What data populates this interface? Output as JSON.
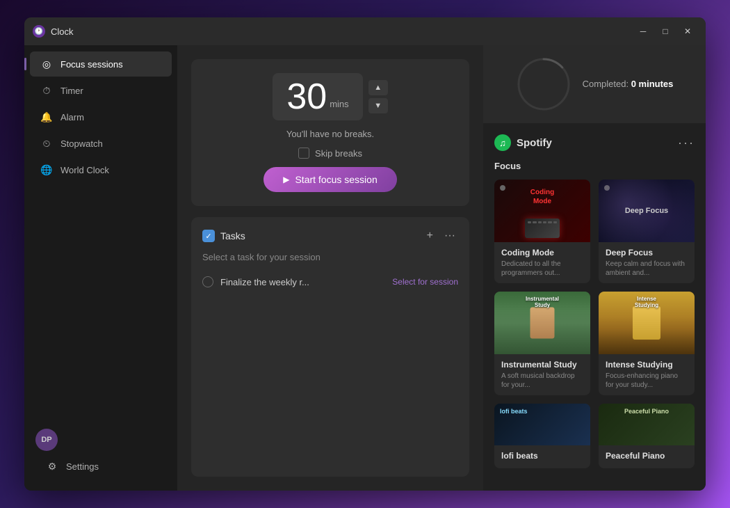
{
  "window": {
    "title": "Clock",
    "app_icon": "🕐"
  },
  "titlebar": {
    "minimize_label": "─",
    "maximize_label": "□",
    "close_label": "✕"
  },
  "sidebar": {
    "items": [
      {
        "id": "focus-sessions",
        "label": "Focus sessions",
        "icon": "◎",
        "active": true
      },
      {
        "id": "timer",
        "label": "Timer",
        "icon": "⏱"
      },
      {
        "id": "alarm",
        "label": "Alarm",
        "icon": "🔔"
      },
      {
        "id": "stopwatch",
        "label": "Stopwatch",
        "icon": "⏲"
      },
      {
        "id": "world-clock",
        "label": "World Clock",
        "icon": "🌐"
      }
    ],
    "avatar_initials": "DP",
    "settings_label": "Settings",
    "settings_icon": "⚙"
  },
  "focus_panel": {
    "time_value": "30",
    "time_unit": "mins",
    "no_breaks_text": "You'll have no breaks.",
    "skip_breaks_label": "Skip breaks",
    "start_button_label": "Start focus session"
  },
  "tasks_panel": {
    "title": "Tasks",
    "select_prompt": "Select a task for your session",
    "add_icon": "+",
    "more_icon": "···",
    "tasks": [
      {
        "name": "Finalize the weekly r...",
        "action_label": "Select for session"
      }
    ]
  },
  "completed_panel": {
    "label": "Completed:",
    "value": "0 minutes"
  },
  "spotify": {
    "name": "Spotify",
    "section_label": "Focus",
    "more_icon": "···",
    "playlists": [
      {
        "id": "coding-mode",
        "name": "Coding Mode",
        "description": "Dedicated to all the programmers out...",
        "dot_color": "gray",
        "thumb_type": "coding"
      },
      {
        "id": "deep-focus",
        "name": "Deep Focus",
        "description": "Keep calm and focus with ambient and...",
        "dot_color": "gray",
        "thumb_type": "deep"
      },
      {
        "id": "instrumental-study",
        "name": "Instrumental Study",
        "description": "A soft musical backdrop for your...",
        "dot_color": "green",
        "thumb_type": "instrumental",
        "thumb_label": "Instrumental\nStudy"
      },
      {
        "id": "intense-studying",
        "name": "Intense Studying",
        "description": "Focus-enhancing piano for your study...",
        "dot_color": "gray",
        "thumb_type": "intense",
        "thumb_label": "Intense\nStudying"
      },
      {
        "id": "lofi-beats",
        "name": "lofi beats",
        "description": "",
        "dot_color": "green",
        "thumb_type": "lofi"
      },
      {
        "id": "peaceful-piano",
        "name": "Peaceful Piano",
        "description": "",
        "dot_color": "gray",
        "thumb_type": "peaceful"
      }
    ]
  }
}
